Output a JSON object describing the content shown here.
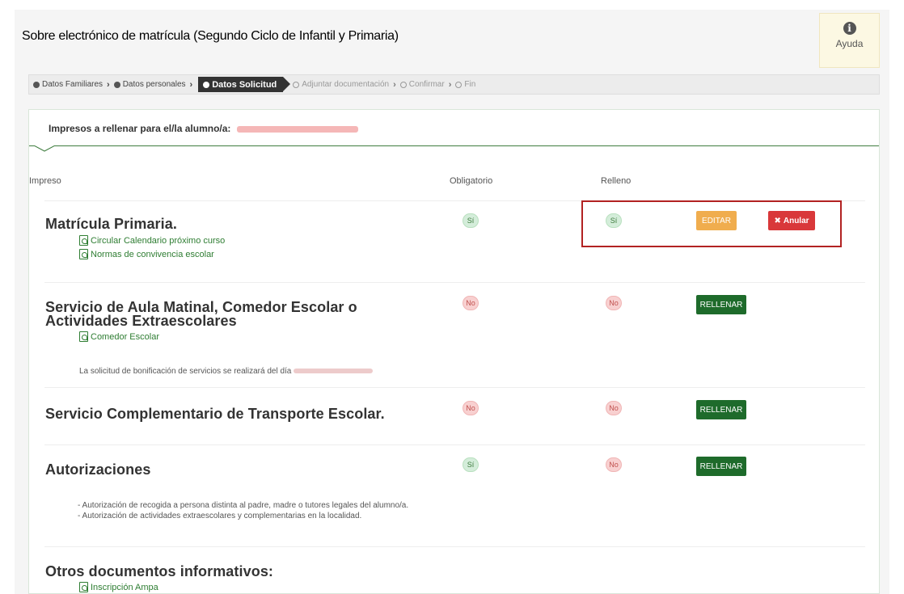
{
  "header": {
    "title": "Sobre electrónico de matrícula (Segundo Ciclo de Infantil y Primaria)",
    "help_label": "Ayuda"
  },
  "breadcrumb": {
    "steps": [
      {
        "label": "Datos Familiares",
        "state": "done"
      },
      {
        "label": "Datos personales",
        "state": "done"
      },
      {
        "label": "Datos Solicitud",
        "state": "active"
      },
      {
        "label": "Adjuntar documentación",
        "state": "todo"
      },
      {
        "label": "Confirmar",
        "state": "todo"
      },
      {
        "label": "Fin",
        "state": "todo"
      }
    ]
  },
  "panel": {
    "heading": "Impresos a rellenar para el/la alumno/a:",
    "columns": {
      "impreso": "Impreso",
      "obligatorio": "Obligatorio",
      "relleno": "Relleno"
    }
  },
  "rows": [
    {
      "title": "Matrícula Primaria.",
      "links": [
        "Circular Calendario próximo curso",
        "Normas de convivencia escolar"
      ],
      "obligatorio": "Sí",
      "relleno": "Sí",
      "actions": [
        "EDITAR",
        "Anular"
      ]
    },
    {
      "title_line1": "Servicio de Aula Matinal, Comedor Escolar o",
      "title_line2": "Actividades Extraescolares",
      "links": [
        "Comedor Escolar"
      ],
      "note": "La solicitud de bonificación de servicios se realizará del día",
      "obligatorio": "No",
      "relleno": "No",
      "actions": [
        "RELLENAR"
      ]
    },
    {
      "title": "Servicio Complementario de Transporte Escolar.",
      "obligatorio": "No",
      "relleno": "No",
      "actions": [
        "RELLENAR"
      ]
    },
    {
      "title": "Autorizaciones",
      "obligatorio": "Sí",
      "relleno": "No",
      "actions": [
        "RELLENAR"
      ],
      "notes": [
        "- Autorización de recogida a persona distinta al padre, madre o tutores legales del alumno/a.",
        "- Autorización de actividades extraescolares y complementarias en la localidad."
      ]
    }
  ],
  "otros": {
    "title": "Otros documentos informativos:",
    "links": [
      "Inscripción Ampa"
    ]
  },
  "colors": {
    "green_button": "#1e6b2b",
    "orange_button": "#f0ad4e",
    "red_button": "#d9383a",
    "highlight_border": "#b22222"
  }
}
